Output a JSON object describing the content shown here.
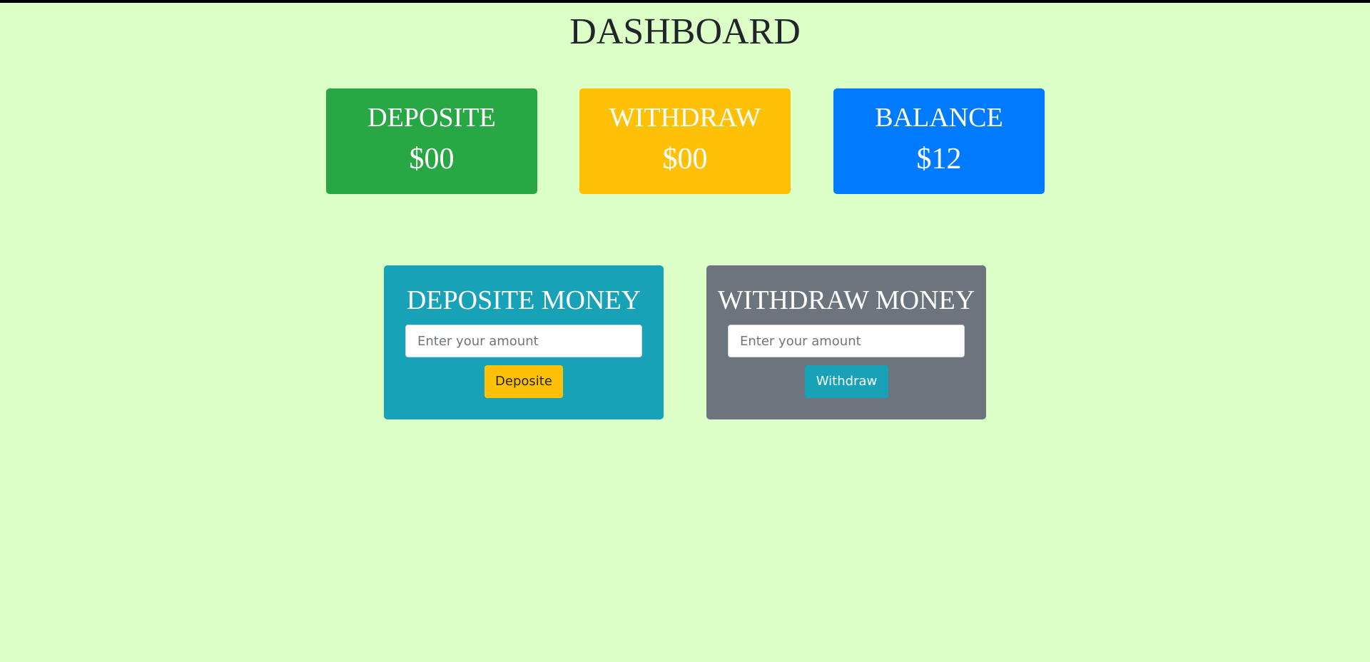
{
  "page": {
    "title": "DASHBOARD",
    "background": "#dbffc7"
  },
  "stats": {
    "deposit": {
      "label": "DEPOSITE",
      "value": "$00",
      "color": "#28a745"
    },
    "withdraw": {
      "label": "WITHDRAW",
      "value": "$00",
      "color": "#ffc107"
    },
    "balance": {
      "label": "BALANCE",
      "value": "$12",
      "color": "#007bff"
    }
  },
  "forms": {
    "deposit": {
      "title": "DEPOSITE MONEY",
      "placeholder": "Enter your amount",
      "value": "",
      "button_label": "Deposite",
      "card_color": "#17a2b8",
      "button_color": "#ffc107",
      "button_text_color": "#212529"
    },
    "withdraw": {
      "title": "WITHDRAW MONEY",
      "placeholder": "Enter your amount",
      "value": "",
      "button_label": "Withdraw",
      "card_color": "#6c757d",
      "button_color": "#17a2b8",
      "button_text_color": "#ffffff"
    }
  }
}
